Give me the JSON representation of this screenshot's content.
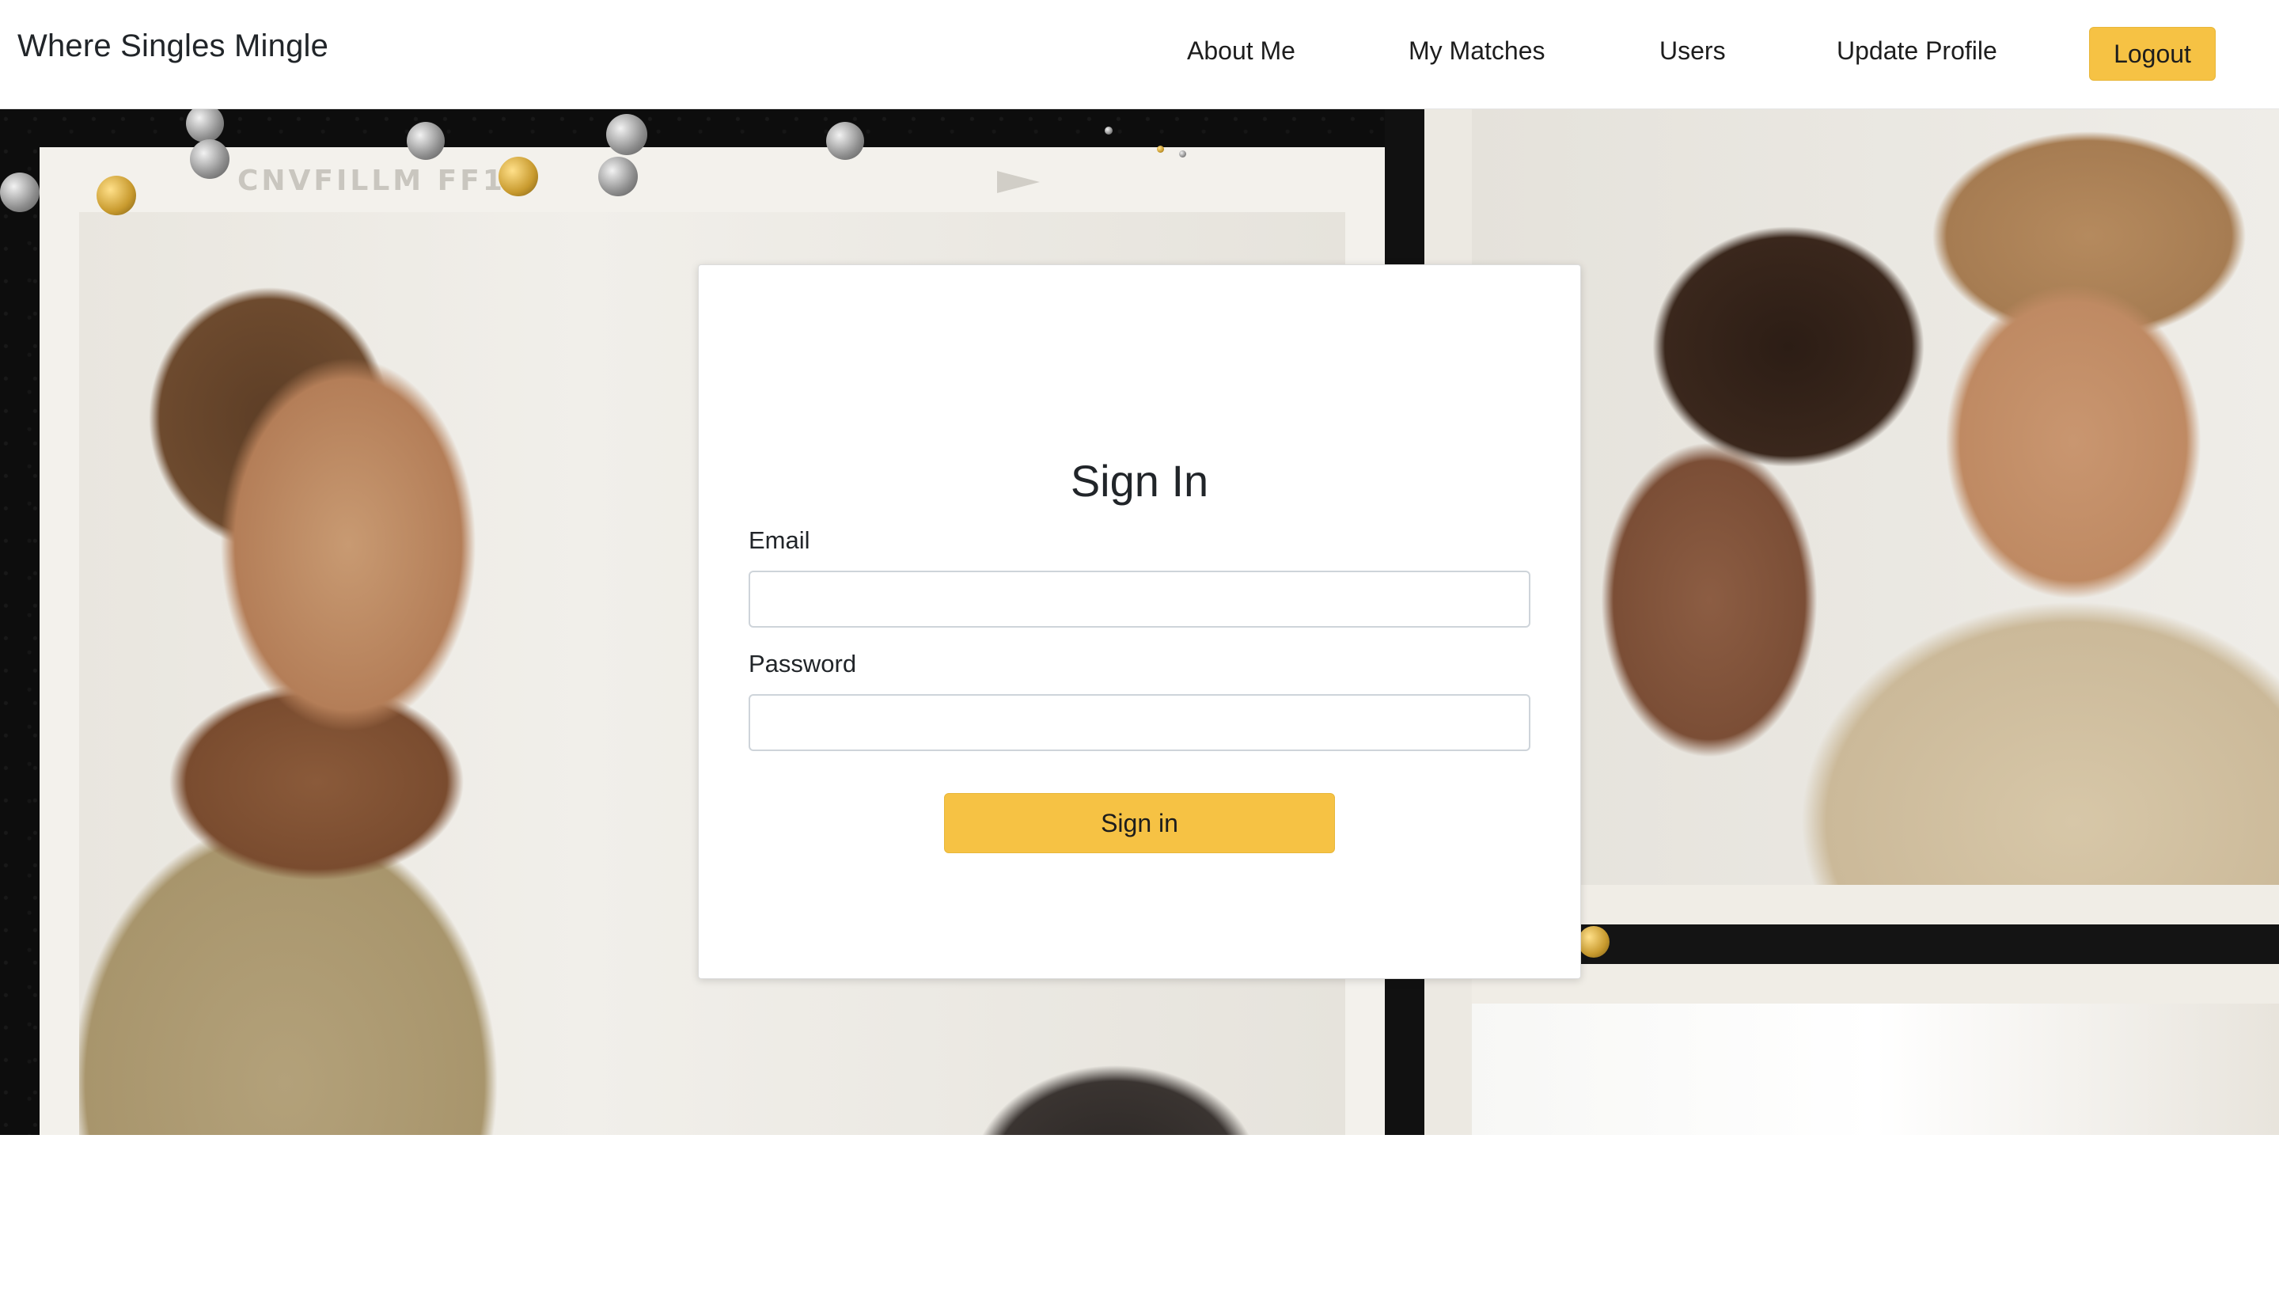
{
  "navbar": {
    "brand": "Where Singles Mingle",
    "links": {
      "about": "About Me",
      "matches": "My Matches",
      "users": "Users",
      "update_profile": "Update Profile"
    },
    "logout_label": "Logout"
  },
  "hero": {
    "film_text": "CNVFILLM FF1"
  },
  "signin": {
    "title": "Sign In",
    "email_label": "Email",
    "email_value": "",
    "password_label": "Password",
    "password_value": "",
    "submit_label": "Sign in"
  },
  "colors": {
    "accent": "#f6c244",
    "text": "#212529",
    "card_bg": "#ffffff"
  }
}
